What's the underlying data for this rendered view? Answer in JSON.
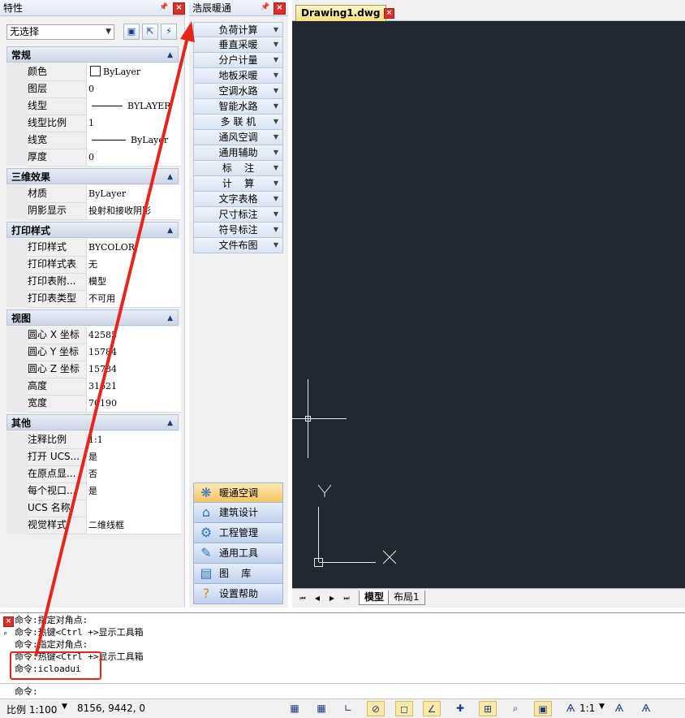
{
  "properties_panel": {
    "title": "特性",
    "pin": "ᵖ",
    "close": "×",
    "selection": "无选择",
    "categories": [
      {
        "title": "常规",
        "rows": [
          {
            "key": "颜色",
            "value": "ByLayer"
          },
          {
            "key": "图层",
            "value": "0"
          },
          {
            "key": "线型",
            "value": "BYLAYER"
          },
          {
            "key": "线型比例",
            "value": "1"
          },
          {
            "key": "线宽",
            "value": "ByLayer"
          },
          {
            "key": "厚度",
            "value": "0"
          }
        ]
      },
      {
        "title": "三维效果",
        "rows": [
          {
            "key": "材质",
            "value": "ByLayer"
          },
          {
            "key": "阴影显示",
            "value": "投射和接收阴影"
          }
        ]
      },
      {
        "title": "打印样式",
        "rows": [
          {
            "key": "打印样式",
            "value": "BYCOLOR"
          },
          {
            "key": "打印样式表",
            "value": "无"
          },
          {
            "key": "打印表附...",
            "value": "模型"
          },
          {
            "key": "打印表类型",
            "value": "不可用"
          }
        ]
      },
      {
        "title": "视图",
        "rows": [
          {
            "key": "圆心 X 坐标",
            "value": "42585"
          },
          {
            "key": "圆心 Y 坐标",
            "value": "15784"
          },
          {
            "key": "圆心 Z 坐标",
            "value": "15784"
          },
          {
            "key": "高度",
            "value": "31621"
          },
          {
            "key": "宽度",
            "value": "70190"
          }
        ]
      },
      {
        "title": "其他",
        "rows": [
          {
            "key": "注释比例",
            "value": "1:1"
          },
          {
            "key": "打开 UCS...",
            "value": "是"
          },
          {
            "key": "在原点显...",
            "value": "否"
          },
          {
            "key": "每个视口...",
            "value": "是"
          },
          {
            "key": "UCS 名称",
            "value": ""
          },
          {
            "key": "视觉样式",
            "value": "二维线框"
          }
        ]
      }
    ]
  },
  "hvac_panel": {
    "title": "浩辰暖通",
    "menu": [
      "负荷计算",
      "垂直采暖",
      "分户计量",
      "地板采暖",
      "空调水路",
      "智能水路",
      "多 联 机",
      "通风空调",
      "通用辅助",
      "标    注",
      "计    算",
      "文字表格",
      "尺寸标注",
      "符号标注",
      "文件布图"
    ],
    "modules": [
      "暖通空调",
      "建筑设计",
      "工程管理",
      "通用工具",
      "图    库",
      "设置帮助"
    ]
  },
  "document": {
    "tab": "Drawing1.dwg",
    "layout_tabs": [
      "模型",
      "布局1"
    ],
    "ucs_labels": {
      "x": "X",
      "y": "Y"
    }
  },
  "command": {
    "history": [
      "命令:指定对角点:",
      "命令:热键<Ctrl +>显示工具箱",
      "命令:指定对角点:",
      "命令:热键<Ctrl +>显示工具箱",
      "命令:icloadui"
    ],
    "prompt": "命令:"
  },
  "status": {
    "scale": "比例 1:100",
    "coords": "8156, 9442, 0",
    "annotation_scale": "1:1"
  },
  "colors": {
    "annotation": "#e8251b",
    "canvas": "#222831",
    "active_module": "#f6c462"
  }
}
